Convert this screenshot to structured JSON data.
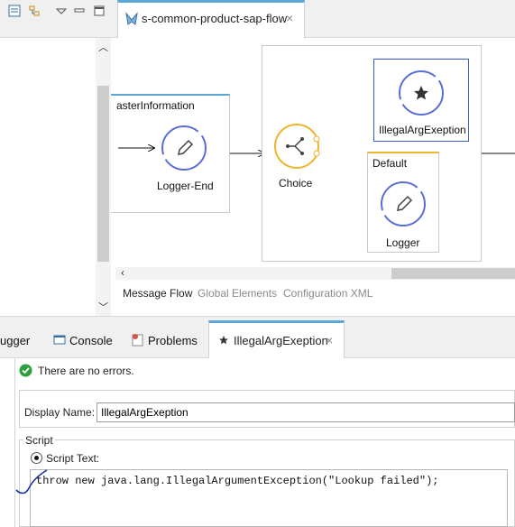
{
  "editor": {
    "tab_label": "s-common-product-sap-flow",
    "tab_close": "×"
  },
  "flow": {
    "left_box_title": "asterInformation",
    "logger_end_label": "Logger-End",
    "choice_label": "Choice",
    "illegal_label": "IllegalArgExeption",
    "default_title": "Default",
    "logger_label": "Logger"
  },
  "editor_subtabs": {
    "message_flow": "Message Flow",
    "global_elements": "Global Elements",
    "configuration_xml": "Configuration XML"
  },
  "panel_tabs": {
    "debugger": "ugger",
    "console": "Console",
    "problems": "Problems",
    "illegal": "IllegalArgExeption",
    "close": "×"
  },
  "properties": {
    "status": "There are no errors.",
    "display_name_label": "Display Name:",
    "display_name_value": "IllegalArgExeption",
    "script_group_label": "Script",
    "script_text_label": "Script Text:",
    "script_code": "throw new java.lang.IllegalArgumentException(\"Lookup failed\");"
  },
  "colors": {
    "accent": "#5aa7d6",
    "processor_ring": "#5a6fd6",
    "choice_ring": "#f0b429",
    "ok_green": "#2e9e3e"
  }
}
